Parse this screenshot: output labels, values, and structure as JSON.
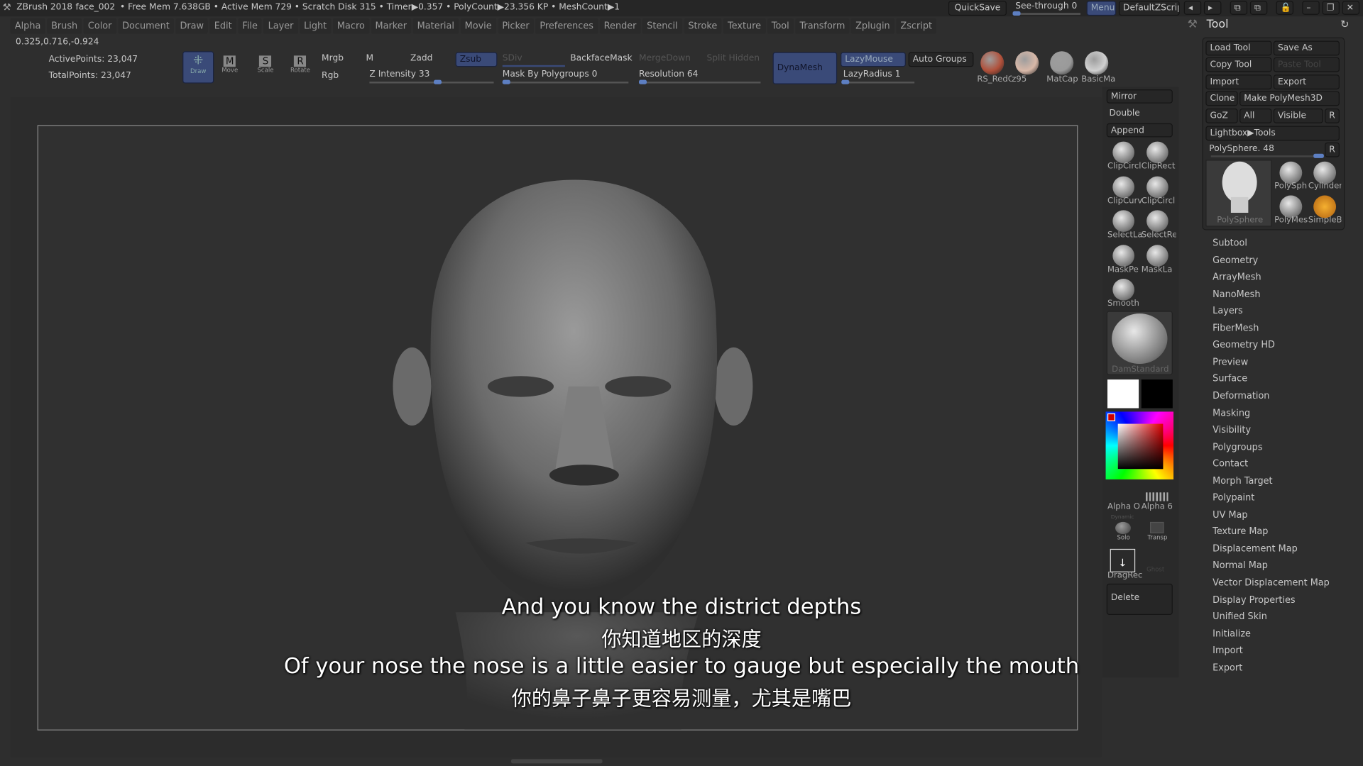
{
  "title_bar": {
    "app": "ZBrush 2018",
    "document": "face_002",
    "stats": "• Free Mem 7.638GB • Active Mem 729 • Scratch Disk 315 •  Timer▶0.357 • PolyCount▶23.356 KP  • MeshCount▶1",
    "quicksave": "QuickSave",
    "see_through": "See-through  0",
    "see_through_value": 0,
    "menus": "Menus",
    "default_zscript": "DefaultZScript"
  },
  "menu_bar": [
    "Alpha",
    "Brush",
    "Color",
    "Document",
    "Draw",
    "Edit",
    "File",
    "Layer",
    "Light",
    "Macro",
    "Marker",
    "Material",
    "Movie",
    "Picker",
    "Preferences",
    "Render",
    "Stencil",
    "Stroke",
    "Texture",
    "Tool",
    "Transform",
    "Zplugin",
    "Zscript"
  ],
  "coords": "0.325,0.716,-0.924",
  "toolbar": {
    "active_points": "ActivePoints: 23,047",
    "total_points": "TotalPoints: 23,047",
    "draw": "Draw",
    "move": "Move",
    "scale": "Scale",
    "rotate": "Rotate",
    "mrgb": "Mrgb",
    "rgb": "Rgb",
    "m": "M",
    "zadd": "Zadd",
    "zsub": "Zsub",
    "sdiv": "SDiv",
    "z_intensity": "Z Intensity 33",
    "z_intensity_value": 33,
    "backface_mask": "BackfaceMask",
    "mask_by_polygroups": "Mask By Polygroups 0",
    "merge_down": "MergeDown",
    "split_hidden": "Split Hidden",
    "resolution": "Resolution 64",
    "dynamesh": "DynaMesh",
    "lazymouse": "LazyMouse",
    "lazyradius": "LazyRadius 1",
    "auto_groups": "Auto Groups",
    "materials": [
      "RS_RedC",
      "z95",
      "MatCap",
      "BasicMa"
    ],
    "material_colors": [
      "#b0503a",
      "#d8b8a8",
      "#9a9a9a",
      "#d0d0d0"
    ]
  },
  "subtitles": [
    "And you know the district depths",
    "你知道地区的深度",
    "Of your nose the nose is a little easier to gauge but especially the mouth",
    "你的鼻子鼻子更容易测量，尤其是嘴巴"
  ],
  "shelf": {
    "mirror": "Mirror",
    "double": "Double",
    "append": "Append",
    "icons": [
      "ClipCircl",
      "ClipRect",
      "ClipCurv",
      "ClipCircl",
      "SelectLa",
      "SelectRe",
      "MaskPe",
      "MaskLa",
      "Smooth"
    ],
    "brush": "DamStandard",
    "alpha": "Alpha O",
    "alpha2": "Alpha 6",
    "dynamic": "Dynamic",
    "solo": "Solo",
    "transp": "Transp",
    "dragrect": "DragRec",
    "ghost": "Ghost",
    "delete": "Delete"
  },
  "tool_panel": {
    "title": "Tool",
    "load_tool": "Load Tool",
    "save_as": "Save As",
    "copy_tool": "Copy Tool",
    "paste_tool": "Paste Tool",
    "import": "Import",
    "export": "Export",
    "clone": "Clone",
    "make_polymesh": "Make PolyMesh3D",
    "goz": "GoZ",
    "all": "All",
    "visible": "Visible",
    "r": "R",
    "lightbox": "Lightbox▶Tools",
    "polysphere": "PolySphere. 48",
    "thumbs": [
      "PolySphere",
      "PolySph",
      "Cylinder",
      "PolyMes",
      "SimpleB"
    ],
    "items": [
      "Subtool",
      "Geometry",
      "ArrayMesh",
      "NanoMesh",
      "Layers",
      "FiberMesh",
      "Geometry HD",
      "Preview",
      "Surface",
      "Deformation",
      "Masking",
      "Visibility",
      "Polygroups",
      "Contact",
      "Morph Target",
      "Polypaint",
      "UV Map",
      "Texture Map",
      "Displacement Map",
      "Normal Map",
      "Vector Displacement Map",
      "Display Properties",
      "Unified Skin",
      "Initialize",
      "Import",
      "Export"
    ]
  }
}
